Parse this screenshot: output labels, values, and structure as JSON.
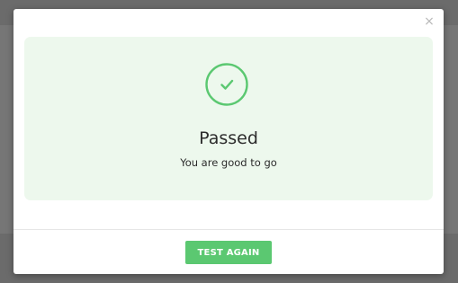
{
  "dialog": {
    "close_glyph": "×",
    "result": {
      "status_icon": "check-circle-icon",
      "title": "Passed",
      "message": "You are good to go"
    },
    "footer": {
      "button_label": "TEST AGAIN"
    }
  },
  "colors": {
    "success": "#5bc871",
    "panel_background": "#edf8ed",
    "backdrop": "#6b6b6b"
  }
}
